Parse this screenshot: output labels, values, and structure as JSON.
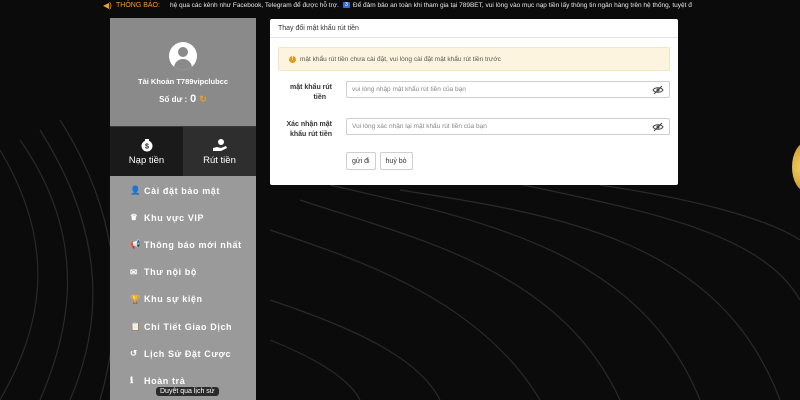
{
  "marquee": {
    "label": "THÔNG BÁO:",
    "text_part1": "hệ qua các kênh như Facebook, Telegram để được hỗ trợ.",
    "number_badge": "3",
    "text_part2": "Để đảm bảo an toàn khi tham gia tại 789BET, vui lòng vào mục nạp tiền lấy thông tin ngân hàng trên hệ thống, tuyệt đ"
  },
  "profile": {
    "account_name": "Tài Khoản T789vipclubcc",
    "balance_label": "Số dư :",
    "balance_value": "0"
  },
  "actions": {
    "deposit": "Nạp tiền",
    "withdraw": "Rút tiền"
  },
  "menu": {
    "items": [
      {
        "label": "Cài đặt bảo mật",
        "icon": "user-lock-icon",
        "glyph": "👤"
      },
      {
        "label": "Khu vực VIP",
        "icon": "crown-icon",
        "glyph": "♛"
      },
      {
        "label": "Thông báo mới nhất",
        "icon": "megaphone-icon",
        "glyph": "📢"
      },
      {
        "label": "Thư nội bộ",
        "icon": "envelope-icon",
        "glyph": "✉"
      },
      {
        "label": "Khu sự kiện",
        "icon": "trophy-icon",
        "glyph": "🏆"
      },
      {
        "label": "Chi Tiết Giao Dịch",
        "icon": "clipboard-icon",
        "glyph": "📋"
      },
      {
        "label": "Lịch Sử Đặt Cược",
        "icon": "history-icon",
        "glyph": "↺"
      },
      {
        "label": "Hoàn trả",
        "icon": "info-circle-icon",
        "glyph": "ℹ"
      }
    ],
    "tooltip": "Duyệt qua lịch sử"
  },
  "panel": {
    "title": "Thay đổi mật khẩu rút tiền",
    "alert": "mật khẩu rút tiền chưa cài đặt, vui lòng cài đặt mật khẩu rút tiền trước",
    "field1_label_line1": "mật khẩu rút",
    "field1_label_line2": "tiền",
    "field1_placeholder": "vui lòng nhập mật khẩu rút tiền của bạn",
    "field2_label_line1": "Xác nhận mật",
    "field2_label_line2": "khẩu rút tiền",
    "field2_placeholder": "Vui lòng xác nhận lại mật khẩu rút tiền của bạn",
    "submit": "gửi đi",
    "cancel": "huỷ bỏ"
  },
  "colors": {
    "accent": "#f0a020",
    "sidebar_profile": "#8a8a8a",
    "sidebar_menu": "#9a9a9a",
    "background": "#0b0b0b"
  }
}
